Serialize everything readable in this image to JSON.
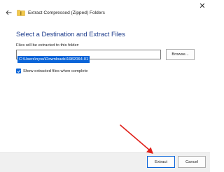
{
  "window": {
    "title": "Extract Compressed (Zipped) Folders",
    "close_glyph": "✕"
  },
  "main": {
    "heading": "Select a Destination and Extract Files",
    "destination_label": "Files will be extracted to this folder:",
    "destination_value": "C:\\Users\\nysu\\Downloads\\1982064-01",
    "browse_label": "Browse...",
    "show_files_label": "Show extracted files when complete",
    "show_files_checked": true
  },
  "footer": {
    "extract_label": "Extract",
    "cancel_label": "Cancel"
  },
  "colors": {
    "heading": "#1b3a8a",
    "accent": "#0a64d8",
    "annotation_arrow": "#e0201a"
  },
  "icons": {
    "back": "back-arrow-icon",
    "folder": "zip-folder-icon",
    "close": "close-icon",
    "check": "checkmark-icon",
    "annotation": "annotation-arrow-icon"
  }
}
